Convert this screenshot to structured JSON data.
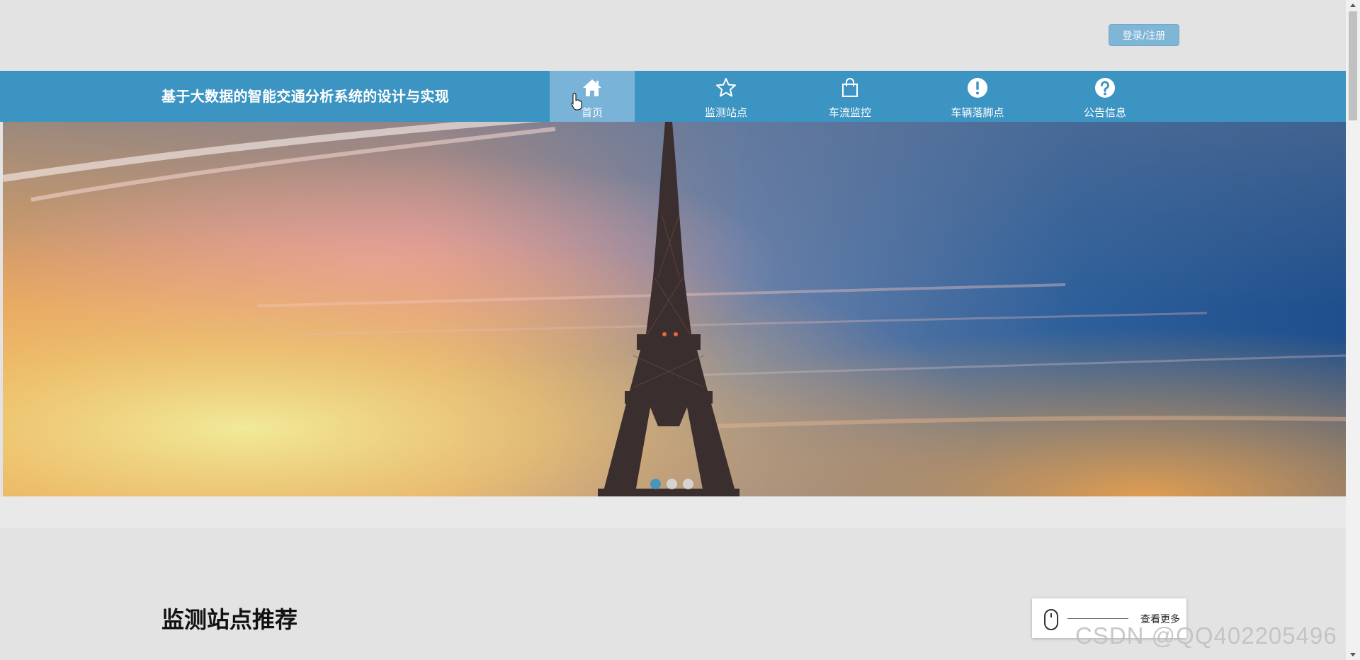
{
  "header": {
    "login_label": "登录/注册",
    "site_title": "基于大数据的智能交通分析系统的设计与实现"
  },
  "nav": {
    "items": [
      {
        "label": "首页",
        "icon": "home-icon",
        "active": true
      },
      {
        "label": "监测站点",
        "icon": "star-icon"
      },
      {
        "label": "车流监控",
        "icon": "shopping-bag-icon"
      },
      {
        "label": "车辆落脚点",
        "icon": "exclamation-circle-icon"
      },
      {
        "label": "公告信息",
        "icon": "question-circle-icon"
      }
    ],
    "active_color": "#7ab3d8",
    "bar_color": "#3b94c2"
  },
  "banner": {
    "slides": 3,
    "active_slide": 1,
    "image_subject": "Eiffel Tower at sunset"
  },
  "section": {
    "title": "监测站点推荐",
    "more_label": "查看更多"
  },
  "watermark": "CSDN @QQ402205496"
}
